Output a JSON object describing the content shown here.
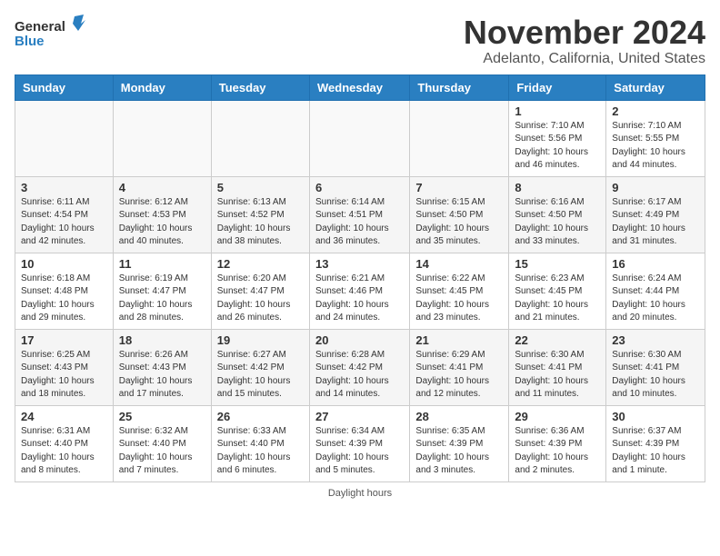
{
  "header": {
    "logo_general": "General",
    "logo_blue": "Blue",
    "title": "November 2024",
    "subtitle": "Adelanto, California, United States"
  },
  "days_of_week": [
    "Sunday",
    "Monday",
    "Tuesday",
    "Wednesday",
    "Thursday",
    "Friday",
    "Saturday"
  ],
  "weeks": [
    [
      {
        "day": "",
        "info": ""
      },
      {
        "day": "",
        "info": ""
      },
      {
        "day": "",
        "info": ""
      },
      {
        "day": "",
        "info": ""
      },
      {
        "day": "",
        "info": ""
      },
      {
        "day": "1",
        "info": "Sunrise: 7:10 AM\nSunset: 5:56 PM\nDaylight: 10 hours and 46 minutes."
      },
      {
        "day": "2",
        "info": "Sunrise: 7:10 AM\nSunset: 5:55 PM\nDaylight: 10 hours and 44 minutes."
      }
    ],
    [
      {
        "day": "3",
        "info": "Sunrise: 6:11 AM\nSunset: 4:54 PM\nDaylight: 10 hours and 42 minutes."
      },
      {
        "day": "4",
        "info": "Sunrise: 6:12 AM\nSunset: 4:53 PM\nDaylight: 10 hours and 40 minutes."
      },
      {
        "day": "5",
        "info": "Sunrise: 6:13 AM\nSunset: 4:52 PM\nDaylight: 10 hours and 38 minutes."
      },
      {
        "day": "6",
        "info": "Sunrise: 6:14 AM\nSunset: 4:51 PM\nDaylight: 10 hours and 36 minutes."
      },
      {
        "day": "7",
        "info": "Sunrise: 6:15 AM\nSunset: 4:50 PM\nDaylight: 10 hours and 35 minutes."
      },
      {
        "day": "8",
        "info": "Sunrise: 6:16 AM\nSunset: 4:50 PM\nDaylight: 10 hours and 33 minutes."
      },
      {
        "day": "9",
        "info": "Sunrise: 6:17 AM\nSunset: 4:49 PM\nDaylight: 10 hours and 31 minutes."
      }
    ],
    [
      {
        "day": "10",
        "info": "Sunrise: 6:18 AM\nSunset: 4:48 PM\nDaylight: 10 hours and 29 minutes."
      },
      {
        "day": "11",
        "info": "Sunrise: 6:19 AM\nSunset: 4:47 PM\nDaylight: 10 hours and 28 minutes."
      },
      {
        "day": "12",
        "info": "Sunrise: 6:20 AM\nSunset: 4:47 PM\nDaylight: 10 hours and 26 minutes."
      },
      {
        "day": "13",
        "info": "Sunrise: 6:21 AM\nSunset: 4:46 PM\nDaylight: 10 hours and 24 minutes."
      },
      {
        "day": "14",
        "info": "Sunrise: 6:22 AM\nSunset: 4:45 PM\nDaylight: 10 hours and 23 minutes."
      },
      {
        "day": "15",
        "info": "Sunrise: 6:23 AM\nSunset: 4:45 PM\nDaylight: 10 hours and 21 minutes."
      },
      {
        "day": "16",
        "info": "Sunrise: 6:24 AM\nSunset: 4:44 PM\nDaylight: 10 hours and 20 minutes."
      }
    ],
    [
      {
        "day": "17",
        "info": "Sunrise: 6:25 AM\nSunset: 4:43 PM\nDaylight: 10 hours and 18 minutes."
      },
      {
        "day": "18",
        "info": "Sunrise: 6:26 AM\nSunset: 4:43 PM\nDaylight: 10 hours and 17 minutes."
      },
      {
        "day": "19",
        "info": "Sunrise: 6:27 AM\nSunset: 4:42 PM\nDaylight: 10 hours and 15 minutes."
      },
      {
        "day": "20",
        "info": "Sunrise: 6:28 AM\nSunset: 4:42 PM\nDaylight: 10 hours and 14 minutes."
      },
      {
        "day": "21",
        "info": "Sunrise: 6:29 AM\nSunset: 4:41 PM\nDaylight: 10 hours and 12 minutes."
      },
      {
        "day": "22",
        "info": "Sunrise: 6:30 AM\nSunset: 4:41 PM\nDaylight: 10 hours and 11 minutes."
      },
      {
        "day": "23",
        "info": "Sunrise: 6:30 AM\nSunset: 4:41 PM\nDaylight: 10 hours and 10 minutes."
      }
    ],
    [
      {
        "day": "24",
        "info": "Sunrise: 6:31 AM\nSunset: 4:40 PM\nDaylight: 10 hours and 8 minutes."
      },
      {
        "day": "25",
        "info": "Sunrise: 6:32 AM\nSunset: 4:40 PM\nDaylight: 10 hours and 7 minutes."
      },
      {
        "day": "26",
        "info": "Sunrise: 6:33 AM\nSunset: 4:40 PM\nDaylight: 10 hours and 6 minutes."
      },
      {
        "day": "27",
        "info": "Sunrise: 6:34 AM\nSunset: 4:39 PM\nDaylight: 10 hours and 5 minutes."
      },
      {
        "day": "28",
        "info": "Sunrise: 6:35 AM\nSunset: 4:39 PM\nDaylight: 10 hours and 3 minutes."
      },
      {
        "day": "29",
        "info": "Sunrise: 6:36 AM\nSunset: 4:39 PM\nDaylight: 10 hours and 2 minutes."
      },
      {
        "day": "30",
        "info": "Sunrise: 6:37 AM\nSunset: 4:39 PM\nDaylight: 10 hours and 1 minute."
      }
    ]
  ],
  "footer": {
    "daylight_label": "Daylight hours"
  }
}
